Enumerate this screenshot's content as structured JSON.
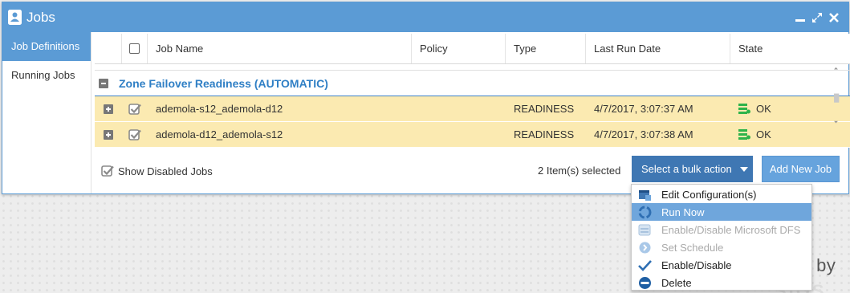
{
  "window": {
    "title": "Jobs"
  },
  "sidebar": {
    "items": [
      {
        "label": "Job Definitions",
        "active": true
      },
      {
        "label": "Running Jobs",
        "active": false
      }
    ]
  },
  "table": {
    "columns": [
      "Job Name",
      "Policy",
      "Type",
      "Last Run Date",
      "State"
    ],
    "group": {
      "title": "Zone Failover Readiness (AUTOMATIC)"
    },
    "rows": [
      {
        "name": "ademola-s12_ademola-d12",
        "policy": "",
        "type": "READINESS",
        "last_run": "4/7/2017, 3:07:37 AM",
        "state": "OK"
      },
      {
        "name": "ademola-d12_ademola-s12",
        "policy": "",
        "type": "READINESS",
        "last_run": "4/7/2017, 3:07:38 AM",
        "state": "OK"
      }
    ]
  },
  "footer": {
    "show_disabled": "Show Disabled Jobs",
    "selected_count": "2 Item(s) selected",
    "bulk_action": "Select a bulk action",
    "add_new": "Add New Job"
  },
  "menu": {
    "items": [
      {
        "label": "Edit Configuration(s)",
        "icon": "edit-config-icon",
        "state": "normal"
      },
      {
        "label": "Run Now",
        "icon": "run-now-icon",
        "state": "highlighted"
      },
      {
        "label": "Enable/Disable Microsoft DFS",
        "icon": "dfs-icon",
        "state": "disabled"
      },
      {
        "label": "Set Schedule",
        "icon": "schedule-icon",
        "state": "disabled"
      },
      {
        "label": "Enable/Disable",
        "icon": "checkmark-icon",
        "state": "normal"
      },
      {
        "label": "Delete",
        "icon": "delete-icon",
        "state": "normal"
      }
    ]
  },
  "background": {
    "powered_text": "ed by"
  },
  "colors": {
    "titlebar": "#5b9bd5",
    "row_selected": "#fbeab1",
    "group_title": "#2f7fc5",
    "bulk_button": "#3f77b3",
    "menu_highlight": "#6fa6dc",
    "state_ok": "#2db34a"
  }
}
